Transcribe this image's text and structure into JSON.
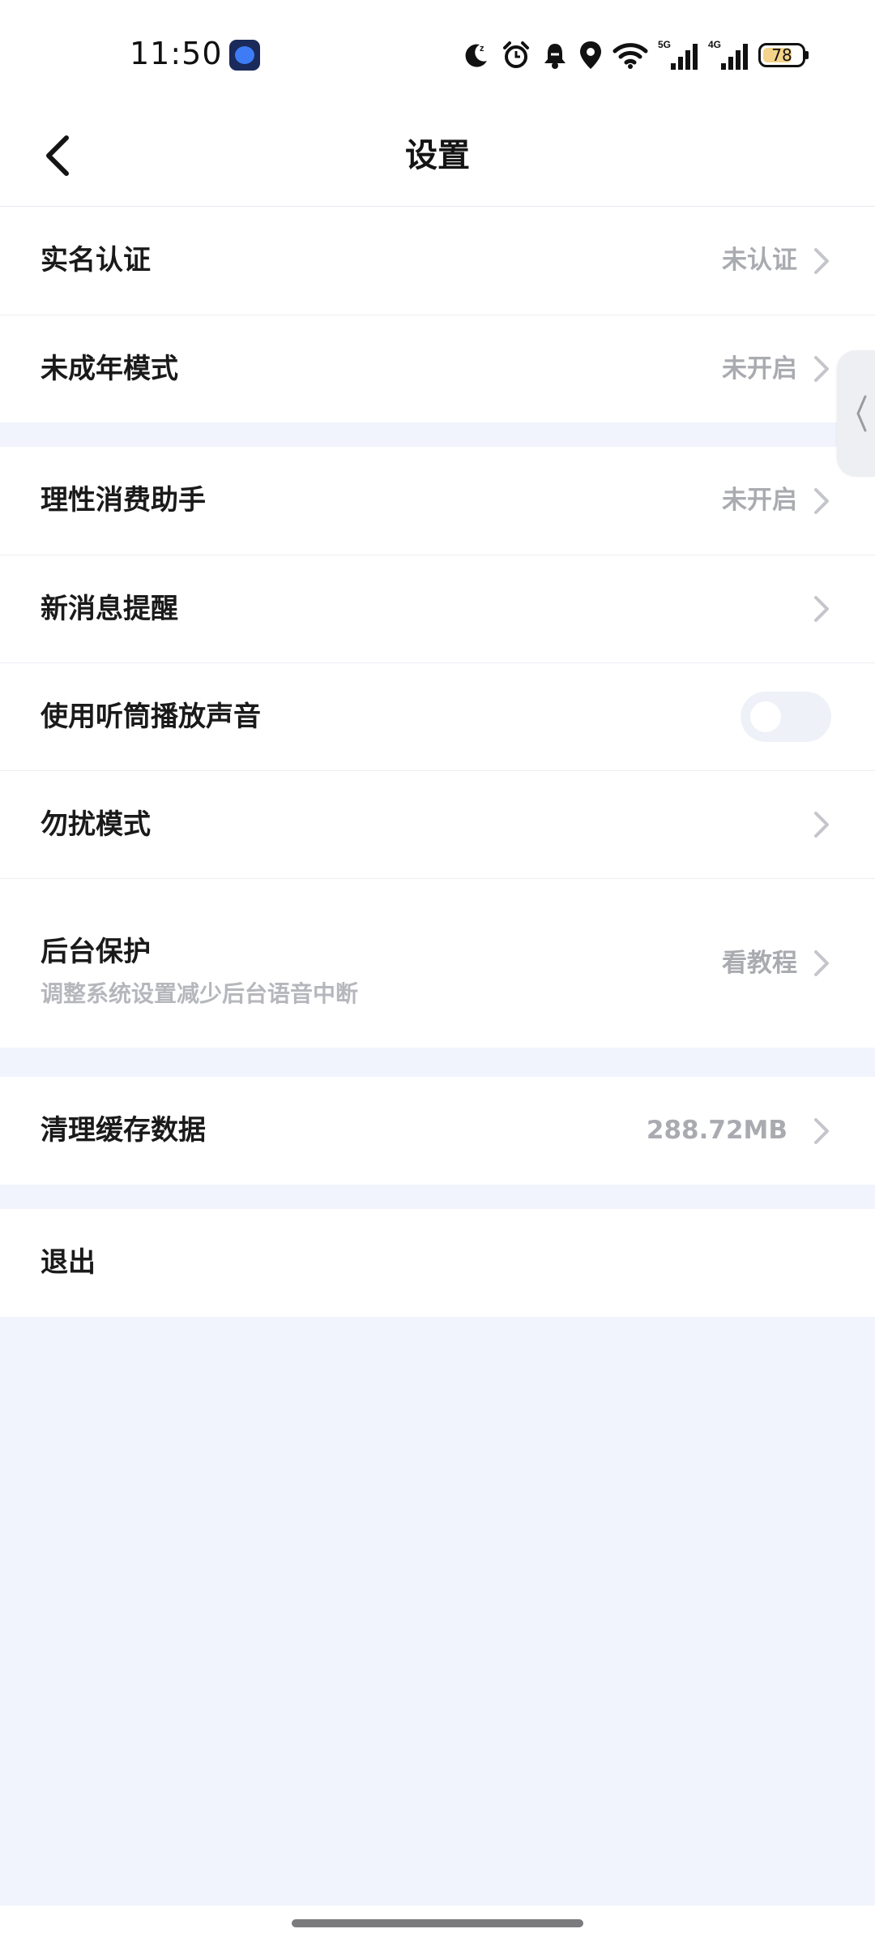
{
  "status_bar": {
    "time": "11:50",
    "icons": [
      "moon-sleep-icon",
      "alarm-icon",
      "bell-icon",
      "location-icon",
      "wifi-icon",
      "signal-5g-icon",
      "signal-4g-icon"
    ],
    "signal_5g_label": "5G",
    "signal_4g_label": "4G",
    "battery_level": "78"
  },
  "header": {
    "title": "设置"
  },
  "groups": [
    {
      "rows": [
        {
          "label": "实名认证",
          "value": "未认证"
        },
        {
          "label": "未成年模式",
          "value": "未开启"
        }
      ]
    },
    {
      "rows": [
        {
          "label": "理性消费助手",
          "value": "未开启"
        },
        {
          "label": "新消息提醒"
        },
        {
          "label": "使用听筒播放声音",
          "toggle": "off"
        },
        {
          "label": "勿扰模式"
        },
        {
          "label": "后台保护",
          "subtitle": "调整系统设置减少后台语音中断",
          "value": "看教程"
        }
      ]
    },
    {
      "rows": [
        {
          "label": "清理缓存数据",
          "value": "288.72MB"
        }
      ]
    },
    {
      "rows": [
        {
          "label": "退出"
        }
      ]
    }
  ],
  "colors": {
    "page_background": "#f1f4fc",
    "card_background": "#ffffff",
    "label_text": "#1a1a1a",
    "secondary_text": "#a9abb0",
    "chevron": "#c4c6cb",
    "toggle_track_off": "#eef1f8"
  }
}
